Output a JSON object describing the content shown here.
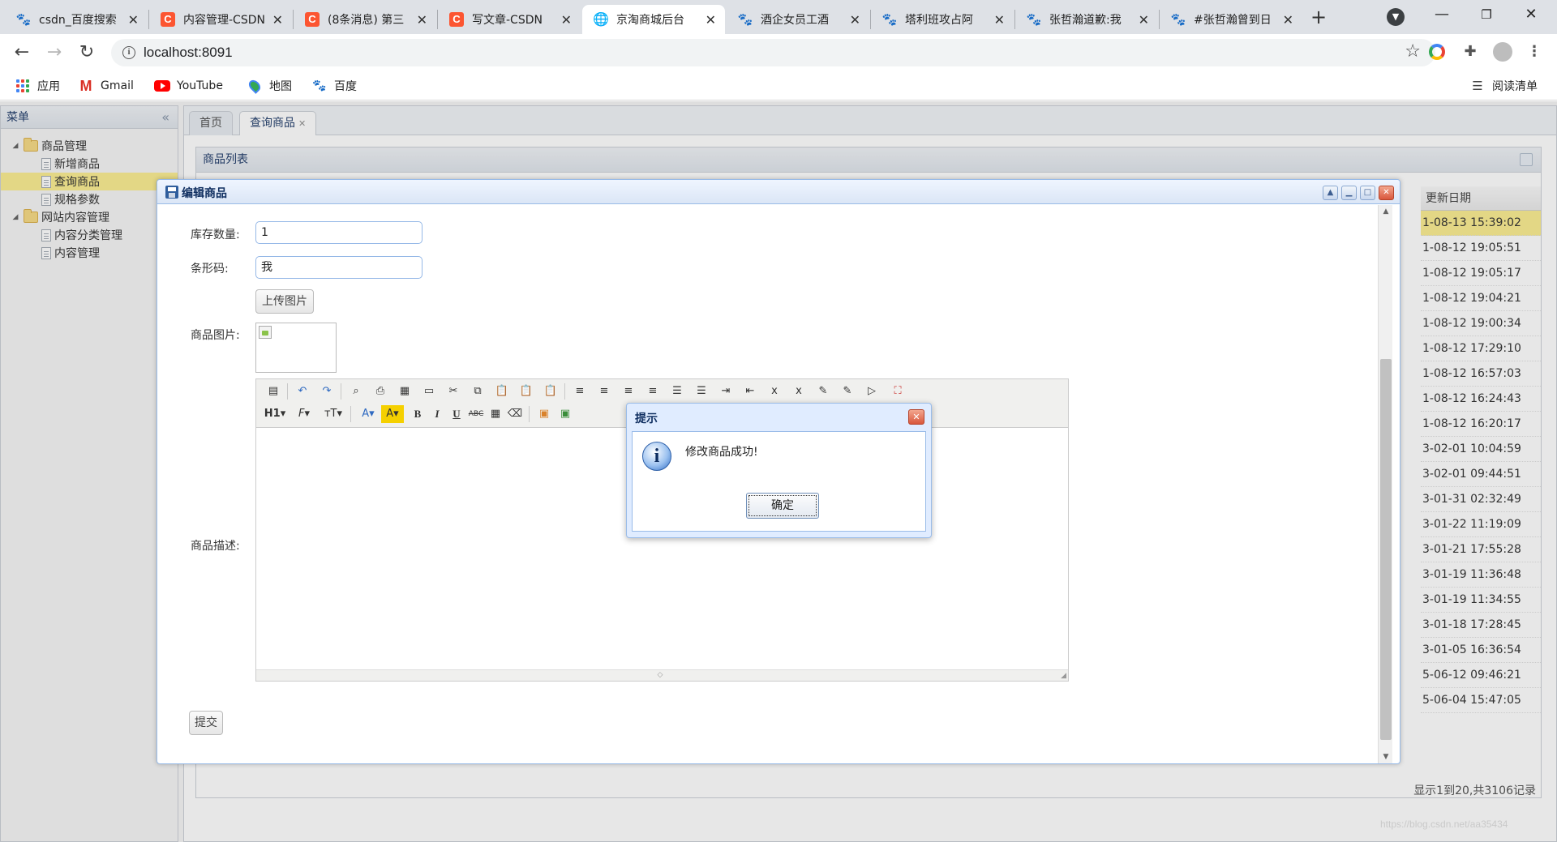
{
  "browser": {
    "tabs": [
      {
        "title": "csdn_百度搜索",
        "icon": "baidu-paw-icon"
      },
      {
        "title": "内容管理-CSDN",
        "icon": "csdn-icon"
      },
      {
        "title": "(8条消息) 第三",
        "icon": "csdn-icon"
      },
      {
        "title": "写文章-CSDN",
        "icon": "csdn-icon"
      },
      {
        "title": "京淘商城后台",
        "icon": "globe-icon",
        "active": true
      },
      {
        "title": "酒企女员工酒",
        "icon": "baidu-paw-icon"
      },
      {
        "title": "塔利班攻占阿",
        "icon": "baidu-paw-icon"
      },
      {
        "title": "张哲瀚道歉:我",
        "icon": "baidu-paw-icon"
      },
      {
        "title": "#张哲瀚曾到日",
        "icon": "baidu-paw-icon"
      }
    ],
    "url": "localhost:8091",
    "bookmarks": [
      {
        "label": "应用",
        "icon": "apps-icon"
      },
      {
        "label": "Gmail",
        "icon": "gmail-icon"
      },
      {
        "label": "YouTube",
        "icon": "youtube-icon"
      },
      {
        "label": "地图",
        "icon": "maps-icon"
      },
      {
        "label": "百度",
        "icon": "baidu-paw-icon"
      }
    ],
    "reading_list": "阅读清单"
  },
  "sidebar": {
    "title": "菜单",
    "tree": [
      {
        "label": "商品管理",
        "type": "folder"
      },
      {
        "label": "新增商品",
        "type": "file"
      },
      {
        "label": "查询商品",
        "type": "file",
        "selected": true
      },
      {
        "label": "规格参数",
        "type": "file"
      },
      {
        "label": "网站内容管理",
        "type": "folder"
      },
      {
        "label": "内容分类管理",
        "type": "file"
      },
      {
        "label": "内容管理",
        "type": "file"
      }
    ]
  },
  "content_tabs": [
    {
      "label": "首页"
    },
    {
      "label": "查询商品",
      "closable": true
    }
  ],
  "list_panel": {
    "title": "商品列表",
    "column_header": "更新日期",
    "rows": [
      "1-08-13 15:39:02",
      "1-08-12 19:05:51",
      "1-08-12 19:05:17",
      "1-08-12 19:04:21",
      "1-08-12 19:00:34",
      "1-08-12 17:29:10",
      "1-08-12 16:57:03",
      "1-08-12 16:24:43",
      "1-08-12 16:20:17",
      "3-02-01 10:04:59",
      "3-02-01 09:44:51",
      "3-01-31 02:32:49",
      "3-01-22 11:19:09",
      "3-01-21 17:55:28",
      "3-01-19 11:36:48",
      "3-01-19 11:34:55",
      "3-01-18 17:28:45",
      "3-01-05 16:36:54",
      "5-06-12 09:46:21",
      "5-06-04 15:47:05"
    ],
    "pager_info": "显示1到20,共3106记录"
  },
  "edit_window": {
    "title": "编辑商品",
    "fields": {
      "stock_label": "库存数量:",
      "stock_value": "1",
      "barcode_label": "条形码:",
      "barcode_value": "我",
      "upload_button": "上传图片",
      "image_label": "商品图片:",
      "desc_label": "商品描述:"
    },
    "submit_button": "提交"
  },
  "message_dialog": {
    "title": "提示",
    "message": "修改商品成功!",
    "ok_button": "确定"
  },
  "watermark": "https://blog.csdn.net/aa35434"
}
